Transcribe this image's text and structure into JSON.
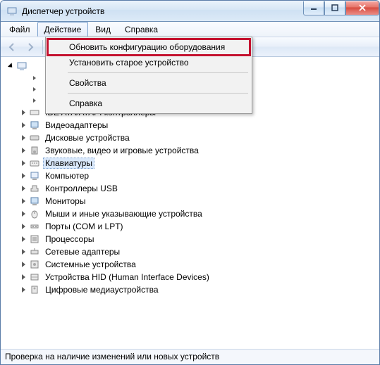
{
  "window": {
    "title": "Диспетчер устройств"
  },
  "menu": {
    "file": "Файл",
    "action": "Действие",
    "view": "Вид",
    "help": "Справка"
  },
  "dropdown": {
    "refresh": "Обновить конфигурацию оборудования",
    "legacy": "Установить старое устройство",
    "properties": "Свойства",
    "help": "Справка"
  },
  "tree": {
    "root_truncated_items": [
      "",
      "",
      ""
    ],
    "categories": [
      {
        "label": "IDE ATA/ATAPI контроллеры"
      },
      {
        "label": "Видеоадаптеры"
      },
      {
        "label": "Дисковые устройства"
      },
      {
        "label": "Звуковые, видео и игровые устройства"
      },
      {
        "label": "Клавиатуры",
        "selected": true
      },
      {
        "label": "Компьютер"
      },
      {
        "label": "Контроллеры USB"
      },
      {
        "label": "Мониторы"
      },
      {
        "label": "Мыши и иные указывающие устройства"
      },
      {
        "label": "Порты (COM и LPT)"
      },
      {
        "label": "Процессоры"
      },
      {
        "label": "Сетевые адаптеры"
      },
      {
        "label": "Системные устройства"
      },
      {
        "label": "Устройства HID (Human Interface Devices)"
      },
      {
        "label": "Цифровые медиаустройства"
      }
    ]
  },
  "status": "Проверка на наличие изменений или новых устройств"
}
